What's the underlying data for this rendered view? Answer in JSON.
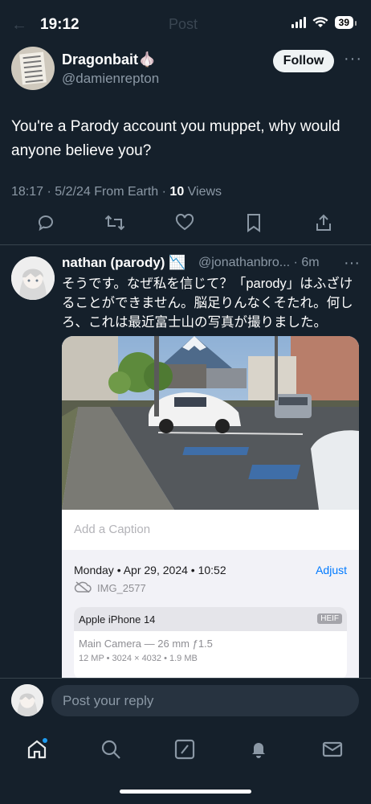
{
  "status_bar": {
    "time": "19:12",
    "battery": "39"
  },
  "header": {
    "faded_title": "Post"
  },
  "post": {
    "author_name": "Dragonbait🧄",
    "author_handle": "@damienrepton",
    "follow_label": "Follow",
    "more": "···",
    "text": "You're a Parody account you muppet, why would anyone believe you?",
    "meta_prefix": "18:17 · 5/2/24 From Earth · ",
    "views_count": "10",
    "views_label": " Views"
  },
  "actions": [
    "reply-icon",
    "repost-icon",
    "like-icon",
    "bookmark-icon",
    "share-icon"
  ],
  "reply": {
    "author_name": "nathan (parody) 📉",
    "author_handle": "@jonathanbro... · 6m",
    "more": "···",
    "text": "そうです。なぜ私を信じて？「parody」はふざけることができません。脳足りんなくそたれ。何しろ、これは最近富士山の写真が撮りました。"
  },
  "photo_info": {
    "caption_placeholder": "Add a Caption",
    "datetime": "Monday • Apr 29, 2024 • 10:52",
    "adjust_label": "Adjust",
    "file_name": "IMG_2577",
    "device": "Apple iPhone 14",
    "format_badge": "HEIF",
    "camera": "Main Camera — 26 mm ƒ1.5",
    "specs": "12 MP  •  3024 × 4032  •  1.9 MB"
  },
  "reply_bar": {
    "placeholder": "Post your reply"
  },
  "tabs": [
    "home-icon",
    "search-icon",
    "grok-icon",
    "notifications-icon",
    "messages-icon"
  ],
  "colors": {
    "background": "#15202b",
    "accent": "#1d9bf0",
    "muted": "#8b98a5",
    "link_blue": "#007aff"
  }
}
